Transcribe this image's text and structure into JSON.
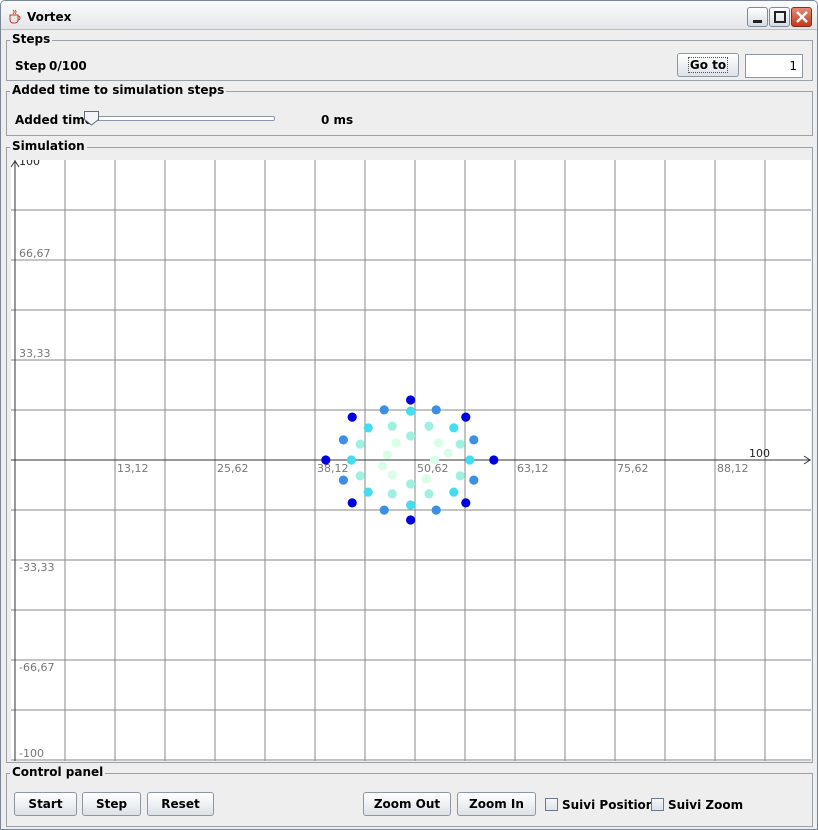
{
  "window": {
    "title": "Vortex",
    "icon": "java-cup-icon"
  },
  "steps_panel": {
    "legend": "Steps",
    "step_label": "Step",
    "step_value": "0/100",
    "goto_label": "Go to",
    "goto_value": "1"
  },
  "time_panel": {
    "legend": "Added time to simulation steps",
    "label": "Added time",
    "slider_value": 0,
    "value_text": "0 ms"
  },
  "simulation": {
    "legend": "Simulation",
    "x_axis": {
      "min": 0,
      "max": 100,
      "label_end": "100",
      "ticks": [
        "13,12",
        "25,62",
        "38,12",
        "50,62",
        "63,12",
        "75,62",
        "88,12"
      ]
    },
    "y_axis": {
      "min": -100,
      "max": 100,
      "ticks": [
        "100",
        "66,67",
        "33,33",
        "-33,33",
        "-66,67",
        "-100"
      ]
    },
    "grid": true,
    "colors": {
      "outer": "#0000e0",
      "ring2": "#3d8fe6",
      "ring3": "#44dcef",
      "ring4": "#9ff0e0",
      "ring5": "#d9fde6",
      "core": "#f4fff6"
    }
  },
  "chart_data": {
    "type": "scatter",
    "title": "",
    "xlim": [
      0,
      100
    ],
    "ylim": [
      -100,
      100
    ],
    "series": [
      {
        "ring": 1,
        "color": "#0000e0",
        "points": [
          [
            60.6,
            0
          ],
          [
            57.1,
            14.3
          ],
          [
            50.2,
            20
          ],
          [
            42.9,
            14.3
          ],
          [
            39.6,
            0
          ],
          [
            42.9,
            -14.3
          ],
          [
            50.2,
            -20
          ],
          [
            57.1,
            -14.3
          ]
        ]
      },
      {
        "ring": 2,
        "color": "#3d8fe6",
        "points": [
          [
            58.1,
            6.7
          ],
          [
            53.4,
            16.7
          ],
          [
            46.9,
            16.7
          ],
          [
            41.8,
            6.7
          ],
          [
            41.8,
            -6.7
          ],
          [
            46.9,
            -16.7
          ],
          [
            53.4,
            -16.7
          ],
          [
            58.1,
            -6.7
          ]
        ]
      },
      {
        "ring": 3,
        "color": "#44dcef",
        "points": [
          [
            57.6,
            0
          ],
          [
            55.6,
            10.7
          ],
          [
            50.2,
            16.3
          ],
          [
            44.9,
            10.7
          ],
          [
            42.8,
            0
          ],
          [
            44.9,
            -10.7
          ],
          [
            50.2,
            -15
          ],
          [
            55.6,
            -10.7
          ]
        ]
      },
      {
        "ring": 4,
        "color": "#9ff0e0",
        "points": [
          [
            56.4,
            5.3
          ],
          [
            52.5,
            11.3
          ],
          [
            47.9,
            11.3
          ],
          [
            43.9,
            5.3
          ],
          [
            43.9,
            -5.3
          ],
          [
            47.9,
            -11.3
          ],
          [
            52.5,
            -11.3
          ],
          [
            56.4,
            -5.3
          ],
          [
            50.2,
            8
          ],
          [
            50.2,
            -8
          ]
        ]
      },
      {
        "ring": 5,
        "color": "#d9fde6",
        "points": [
          [
            53.7,
            5.7
          ],
          [
            48.4,
            5.7
          ],
          [
            47.3,
            1.7
          ],
          [
            53.2,
            0
          ],
          [
            52.2,
            -6.3
          ],
          [
            47.9,
            -5
          ],
          [
            46.7,
            -2
          ],
          [
            54.9,
            2.3
          ]
        ]
      }
    ]
  },
  "control_panel": {
    "legend": "Control panel",
    "start": "Start",
    "step": "Step",
    "reset": "Reset",
    "zoom_out": "Zoom Out",
    "zoom_in": "Zoom In",
    "follow_position": "Suivi Position",
    "follow_zoom": "Suivi Zoom"
  }
}
